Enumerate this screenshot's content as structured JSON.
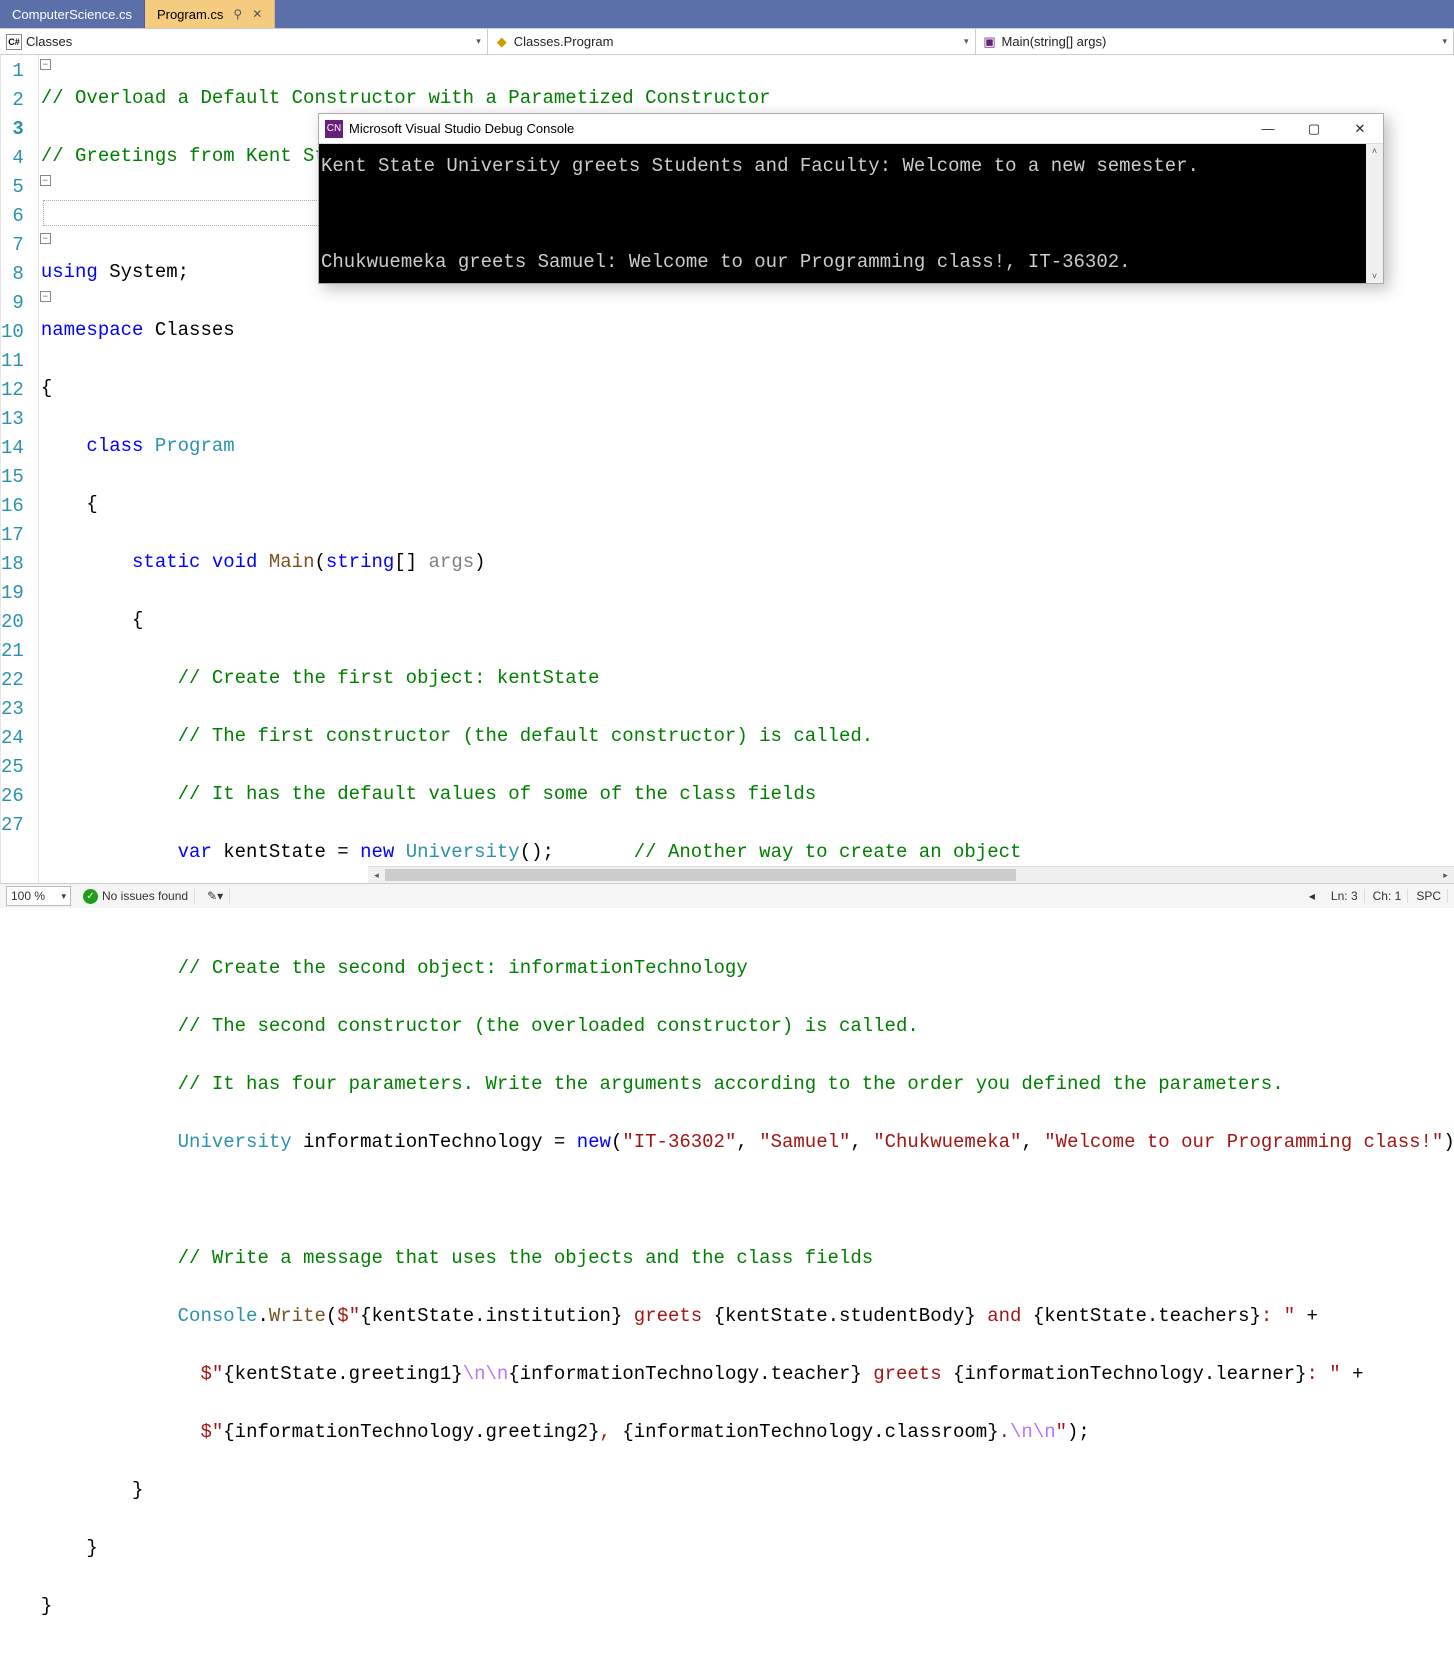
{
  "tabs": [
    {
      "label": "ComputerScience.cs",
      "active": false
    },
    {
      "label": "Program.cs",
      "active": true
    }
  ],
  "tab_pin_glyph": "⚲",
  "tab_close_glyph": "✕",
  "navbar": {
    "scope_icon_text": "C#",
    "scope": "Classes",
    "class": "Classes.Program",
    "member": "Main(string[] args)"
  },
  "code": {
    "l1": "// Overload a Default Constructor with a Parametized Constructor",
    "l2": "// Greetings from Kent State University to Students and Faculty; and From Faculty: Chukwuemeka to Student: Samuel",
    "l4a": "using",
    "l4b": " System;",
    "l5a": "namespace",
    "l5b": " Classes",
    "l6": "{",
    "l7a": "    class ",
    "l7b": "Program",
    "l8": "    {",
    "l9a": "        static void ",
    "l9b": "Main",
    "l9c": "(",
    "l9d": "string",
    "l9e": "[] ",
    "l9f": "args",
    "l9g": ")",
    "l10": "        {",
    "l11": "            // Create the first object: kentState",
    "l12": "            // The first constructor (the default constructor) is called.",
    "l13": "            // It has the default values of some of the class fields",
    "l14a": "            var",
    "l14b": " kentState = ",
    "l14c": "new ",
    "l14d": "University",
    "l14e": "();       ",
    "l14f": "// Another way to create an object",
    "l16": "            // Create the second object: informationTechnology",
    "l17": "            // The second constructor (the overloaded constructor) is called.",
    "l18": "            // It has four parameters. Write the arguments according to the order you defined the parameters.",
    "l19a": "            ",
    "l19b": "University",
    "l19c": " informationTechnology = ",
    "l19d": "new",
    "l19e": "(",
    "l19f": "\"IT-36302\"",
    "l19g": ", ",
    "l19h": "\"Samuel\"",
    "l19i": ", ",
    "l19j": "\"Chukwuemeka\"",
    "l19k": ", ",
    "l19l": "\"Welcome to our Programming class!\"",
    "l19m": ");",
    "l21": "            // Write a message that uses the objects and the class fields",
    "l22a": "            ",
    "l22b": "Console",
    "l22c": ".",
    "l22d": "Write",
    "l22e": "(",
    "l22f": "$\"",
    "l22g": "{kentState.institution}",
    "l22h": " greets ",
    "l22i": "{kentState.studentBody}",
    "l22j": " and ",
    "l22k": "{kentState.teachers}",
    "l22l": ": \"",
    "l22m": " +",
    "l23a": "              ",
    "l23b": "$\"",
    "l23c": "{kentState.greeting1}",
    "l23d": "\\n\\n",
    "l23e": "{informationTechnology.teacher}",
    "l23f": " greets ",
    "l23g": "{informationTechnology.learner}",
    "l23h": ": \"",
    "l23i": " +",
    "l24a": "              ",
    "l24b": "$\"",
    "l24c": "{informationTechnology.greeting2}",
    "l24d": ", ",
    "l24e": "{informationTechnology.classroom}",
    "l24f": ".",
    "l24g": "\\n\\n",
    "l24h": "\"",
    "l24i": ");",
    "l25": "        }",
    "l26": "    }",
    "l27": "}"
  },
  "line_numbers": [
    "1",
    "2",
    "3",
    "4",
    "5",
    "6",
    "7",
    "8",
    "9",
    "10",
    "11",
    "12",
    "13",
    "14",
    "15",
    "16",
    "17",
    "18",
    "19",
    "20",
    "21",
    "22",
    "23",
    "24",
    "25",
    "26",
    "27"
  ],
  "outline_minus": "−",
  "console": {
    "icon_text": "CN",
    "title": "Microsoft Visual Studio Debug Console",
    "min_glyph": "—",
    "max_glyph": "▢",
    "close_glyph": "✕",
    "scroll_up": "˄",
    "scroll_down": "˅",
    "line1": "Kent State University greets Students and Faculty: Welcome to a new semester.",
    "blank": "",
    "line2": "Chukwuemeka greets Samuel: Welcome to our Programming class!, IT-36302."
  },
  "status": {
    "zoom": "100 %",
    "zoom_arrow": "▾",
    "issues": "No issues found",
    "arrow_left": "◂",
    "arrow_right": "▸",
    "ln": "Ln: 3",
    "ch": "Ch: 1",
    "spc": "SPC",
    "tool_glyph": "✎▾"
  }
}
